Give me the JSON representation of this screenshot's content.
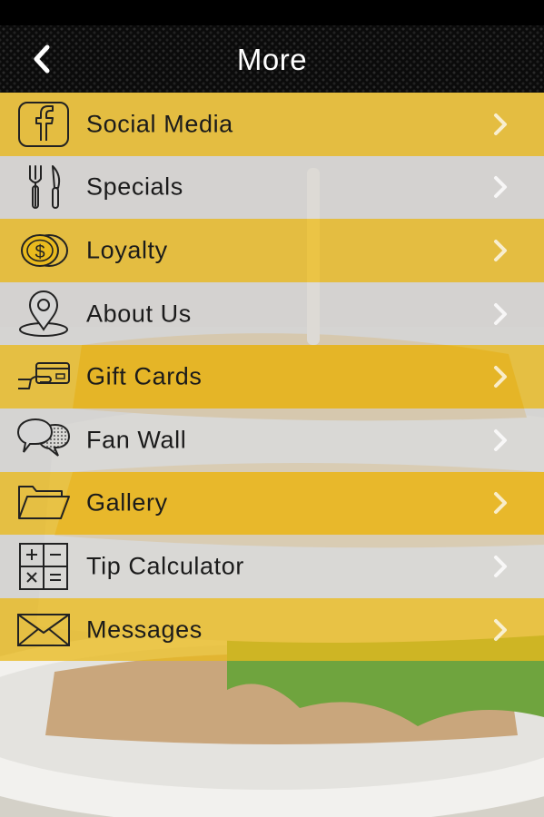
{
  "header": {
    "title": "More"
  },
  "menu": {
    "items": [
      {
        "label": "Social Media",
        "icon": "facebook-icon"
      },
      {
        "label": "Specials",
        "icon": "fork-knife-icon"
      },
      {
        "label": "Loyalty",
        "icon": "coins-icon"
      },
      {
        "label": "About Us",
        "icon": "map-pin-icon"
      },
      {
        "label": "Gift Cards",
        "icon": "gift-card-icon"
      },
      {
        "label": "Fan Wall",
        "icon": "chat-bubbles-icon"
      },
      {
        "label": "Gallery",
        "icon": "folder-icon"
      },
      {
        "label": "Tip Calculator",
        "icon": "calculator-icon"
      },
      {
        "label": "Messages",
        "icon": "envelope-icon"
      }
    ]
  },
  "colors": {
    "gold_row": "#E9BA1E",
    "grey_row": "#D6D6D6",
    "header": "#0B0B0B"
  }
}
